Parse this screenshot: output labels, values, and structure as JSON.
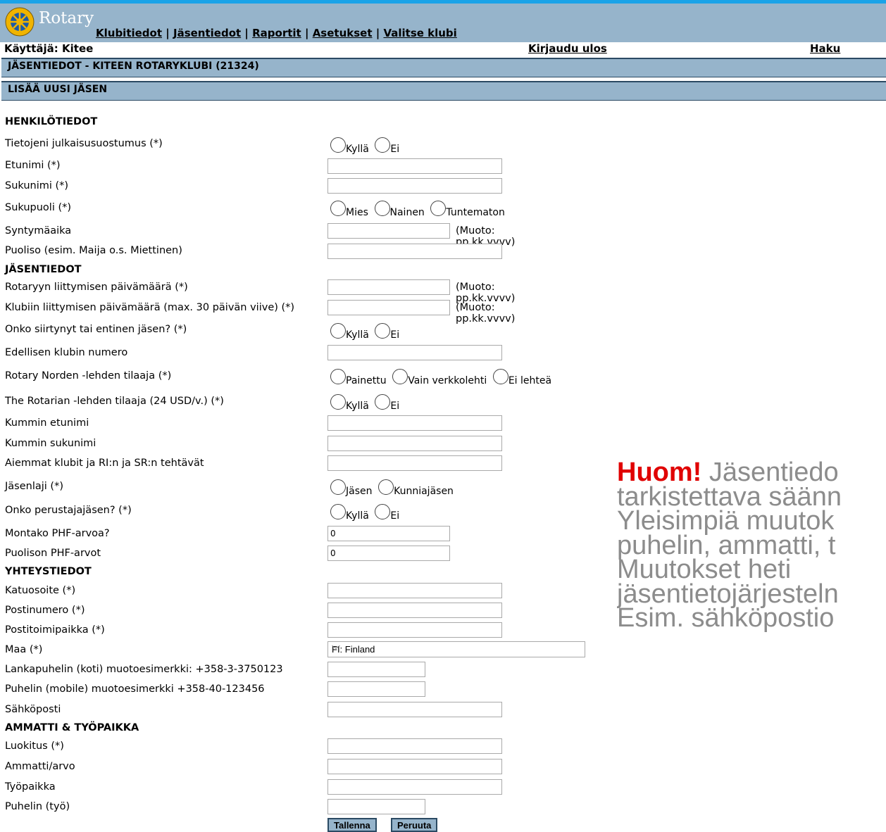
{
  "logo": {
    "text": "Rotary"
  },
  "nav": {
    "items": [
      "Klubitiedot",
      "Jäsentiedot",
      "Raportit",
      "Asetukset",
      "Valitse klubi"
    ],
    "separator": "|"
  },
  "userbar": {
    "user": "Käyttäjä: Kitee",
    "logout": "Kirjaudu ulos",
    "search": "Haku"
  },
  "bars": {
    "section_title": "JÄSENTIEDOT - KITEEN ROTARYKLUBI (21324)",
    "subtitle": "LISÄÄ UUSI JÄSEN"
  },
  "form": {
    "sections": {
      "personal": "HENKILÖTIEDOT",
      "member": "JÄSENTIEDOT",
      "contact": "YHTEYSTIEDOT",
      "work": "AMMATTI & TYÖPAIKKA"
    },
    "labels": {
      "consent": "Tietojeni julkaisusuostumus (*)",
      "firstname": "Etunimi (*)",
      "lastname": "Sukunimi (*)",
      "gender": "Sukupuoli (*)",
      "birthdate": "Syntymäaika",
      "spouse": "Puoliso (esim. Maija o.s. Miettinen)",
      "rotary_join": "Rotaryyn liittymisen päivämäärä (*)",
      "club_join": "Klubiin liittymisen päivämäärä (max. 30 päivän viive) (*)",
      "transferred": "Onko siirtynyt tai entinen jäsen? (*)",
      "prev_club": "Edellisen klubin numero",
      "norden": "Rotary Norden -lehden tilaaja (*)",
      "rotarian": "The Rotarian -lehden tilaaja (24 USD/v.) (*)",
      "sponsor_first": "Kummin etunimi",
      "sponsor_last": "Kummin sukunimi",
      "prev_clubs": "Aiemmat klubit ja RI:n ja SR:n tehtävät",
      "member_type": "Jäsenlaji (*)",
      "founder": "Onko perustajajäsen? (*)",
      "phf": "Montako PHF-arvoa?",
      "spouse_phf": "Puolison PHF-arvot",
      "street": "Katuosoite (*)",
      "postcode": "Postinumero (*)",
      "city": "Postitoimipaikka (*)",
      "country": "Maa (*)",
      "landline": "Lankapuhelin (koti) muotoesimerkki: +358-3-3750123",
      "mobile": "Puhelin (mobile) muotoesimerkki +358-40-123456",
      "email": "Sähköposti",
      "classification": "Luokitus (*)",
      "profession": "Ammatti/arvo",
      "workplace": "Työpaikka",
      "work_phone": "Puhelin (työ)"
    },
    "date_hint": "(Muoto: pp.kk.vvvv)",
    "options": {
      "yes": "Kyllä",
      "no": "Ei",
      "male": "Mies",
      "female": "Nainen",
      "unknown": "Tuntematon",
      "printed": "Painettu",
      "online": "Vain verkkolehti",
      "no_mag": "Ei lehteä",
      "member": "Jäsen",
      "honorary": "Kunniajäsen"
    },
    "values": {
      "phf": "0",
      "spouse_phf": "0",
      "country": "FI: Finland"
    },
    "buttons": {
      "save": "Tallenna",
      "cancel": "Peruuta"
    }
  },
  "note": {
    "huom": "Huom!",
    "lines": [
      "Jäsentiedo",
      "tarkistettava säänn",
      "Yleisimpiä muutok",
      "puhelin, ammatti, t",
      "Muutokset heti",
      "jäsentietojärjesteln",
      "Esim. sähköpostio"
    ]
  }
}
